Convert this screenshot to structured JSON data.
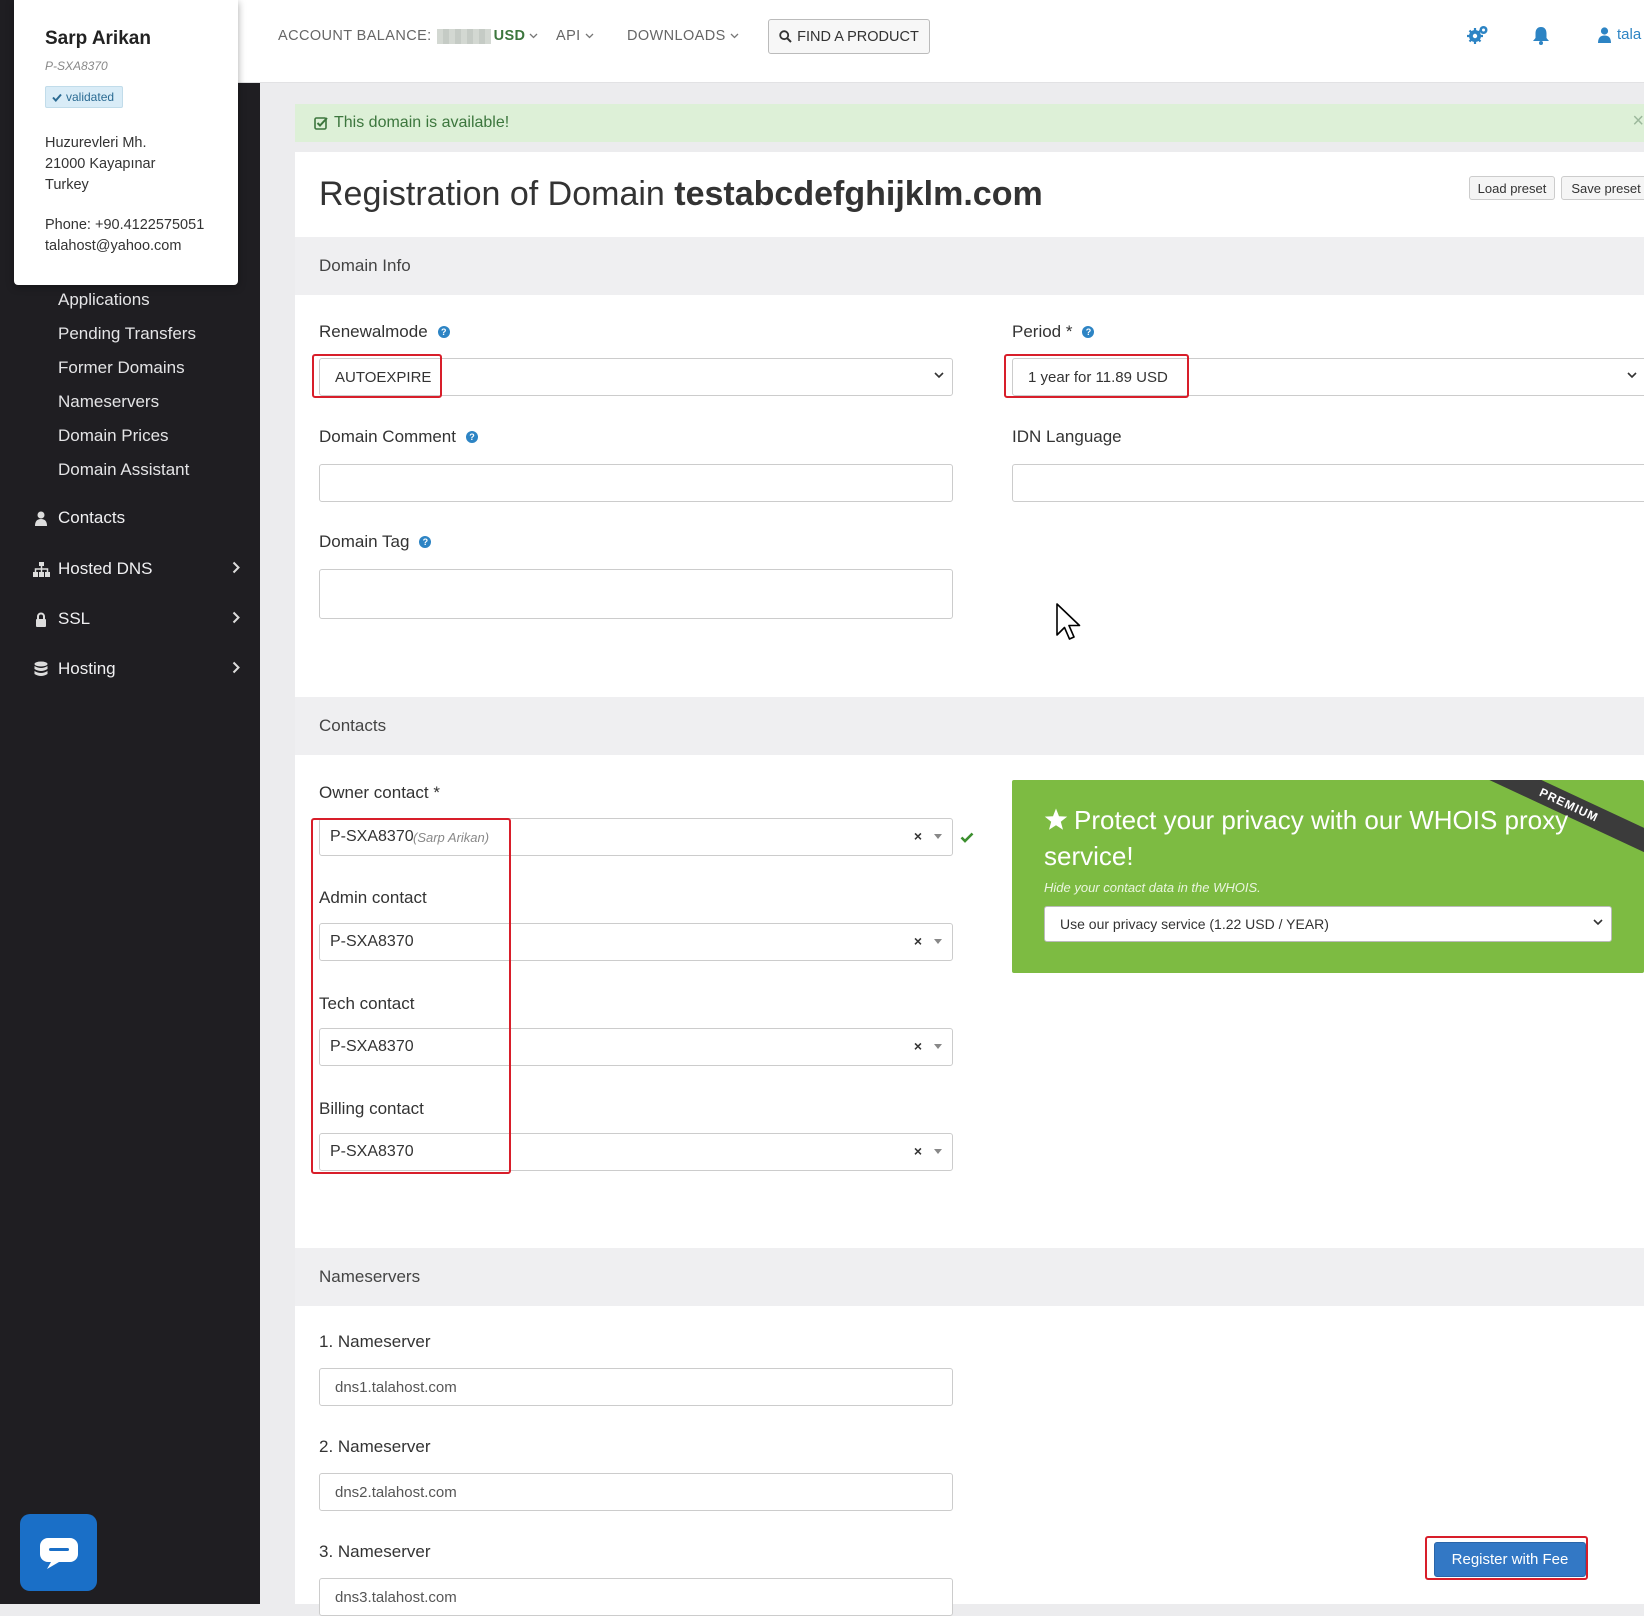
{
  "profile": {
    "name": "Sarp Arikan",
    "id": "P-SXA8370",
    "badge": "validated",
    "address": [
      "Huzurevleri Mh.",
      "21000 Kayapınar",
      "Turkey"
    ],
    "phone": "Phone: +90.4122575051",
    "email": "talahost@yahoo.com"
  },
  "sidebar": {
    "sub_items": [
      "Applications",
      "Pending Transfers",
      "Former Domains",
      "Nameservers",
      "Domain Prices",
      "Domain Assistant"
    ],
    "main_items": [
      {
        "label": "Contacts",
        "icon": "user-icon"
      },
      {
        "label": "Hosted DNS",
        "icon": "sitemap-icon"
      },
      {
        "label": "SSL",
        "icon": "lock-icon"
      },
      {
        "label": "Hosting",
        "icon": "database-icon"
      }
    ]
  },
  "topbar": {
    "balance_label": "ACCOUNT BALANCE:",
    "balance_currency": "USD",
    "api": "API",
    "downloads": "DOWNLOADS",
    "find_product": "FIND A PRODUCT",
    "user_partial": "tala"
  },
  "alert": {
    "text": "This domain is available!",
    "close": "×"
  },
  "page": {
    "title_prefix": "Registration of Domain",
    "domain": "testabcdefghijklm.com",
    "load_preset": "Load preset",
    "save_preset": "Save preset"
  },
  "domain_info": {
    "heading": "Domain Info",
    "renewalmode_label": "Renewalmode",
    "renewalmode_value": "AUTOEXPIRE",
    "period_label": "Period *",
    "period_value": "1 year for 11.89 USD",
    "comment_label": "Domain Comment",
    "idn_label": "IDN Language",
    "tag_label": "Domain Tag"
  },
  "contacts": {
    "heading": "Contacts",
    "owner_label": "Owner contact *",
    "owner_value": "P-SXA8370",
    "owner_name": "(Sarp Arikan)",
    "admin_label": "Admin contact",
    "admin_value": "P-SXA8370",
    "tech_label": "Tech contact",
    "tech_value": "P-SXA8370",
    "billing_label": "Billing contact",
    "billing_value": "P-SXA8370",
    "clear": "×"
  },
  "promo": {
    "title": "Protect your privacy with our WHOIS proxy service!",
    "subtitle": "Hide your contact data in the WHOIS.",
    "select_value": "Use our privacy service (1.22 USD / YEAR)",
    "ribbon": "PREMIUM",
    "color": "#7dbb42"
  },
  "nameservers": {
    "heading": "Nameservers",
    "ns1_label": "1. Nameserver",
    "ns1_value": "dns1.talahost.com",
    "ns2_label": "2. Nameserver",
    "ns2_value": "dns2.talahost.com",
    "ns3_label": "3. Nameserver",
    "ns3_value": "dns3.talahost.com"
  },
  "register_button": "Register with Fee",
  "colors": {
    "accent": "#2d84c4",
    "sidebar": "#1f1e22",
    "highlight": "#d81e2a",
    "success": "#3c763d"
  }
}
